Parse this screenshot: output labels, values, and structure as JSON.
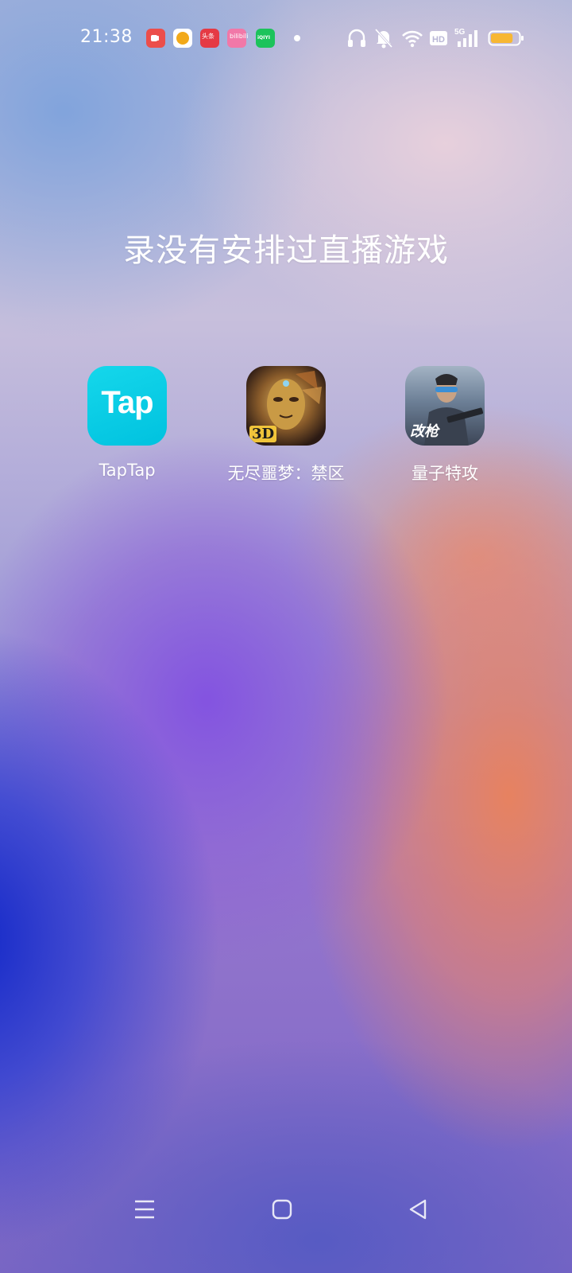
{
  "status_bar": {
    "time": "21:38",
    "notifications": [
      {
        "name": "video-app-icon"
      },
      {
        "name": "kids-app-icon"
      },
      {
        "name": "toutiao-icon",
        "text": "头条"
      },
      {
        "name": "bilibili-icon",
        "text": "bilibili"
      },
      {
        "name": "iqiyi-icon",
        "text": "iQIYI"
      }
    ],
    "network": "5G",
    "hd": "HD",
    "battery_level": 0.8,
    "battery_color": "#f7b733"
  },
  "main": {
    "title": "录没有安排过直播游戏",
    "apps": [
      {
        "label": "TapTap",
        "icon_text": "Tap",
        "icon": "taptap-icon",
        "color": "#00c2df"
      },
      {
        "label": "无尽噩梦：禁区",
        "icon_text": "3D",
        "icon": "mask-game-icon"
      },
      {
        "label": "量子特攻",
        "icon_text": "改枪",
        "icon": "soldier-game-icon"
      }
    ]
  },
  "nav_bar": {
    "buttons": [
      "menu-icon",
      "home-icon",
      "back-icon"
    ]
  }
}
